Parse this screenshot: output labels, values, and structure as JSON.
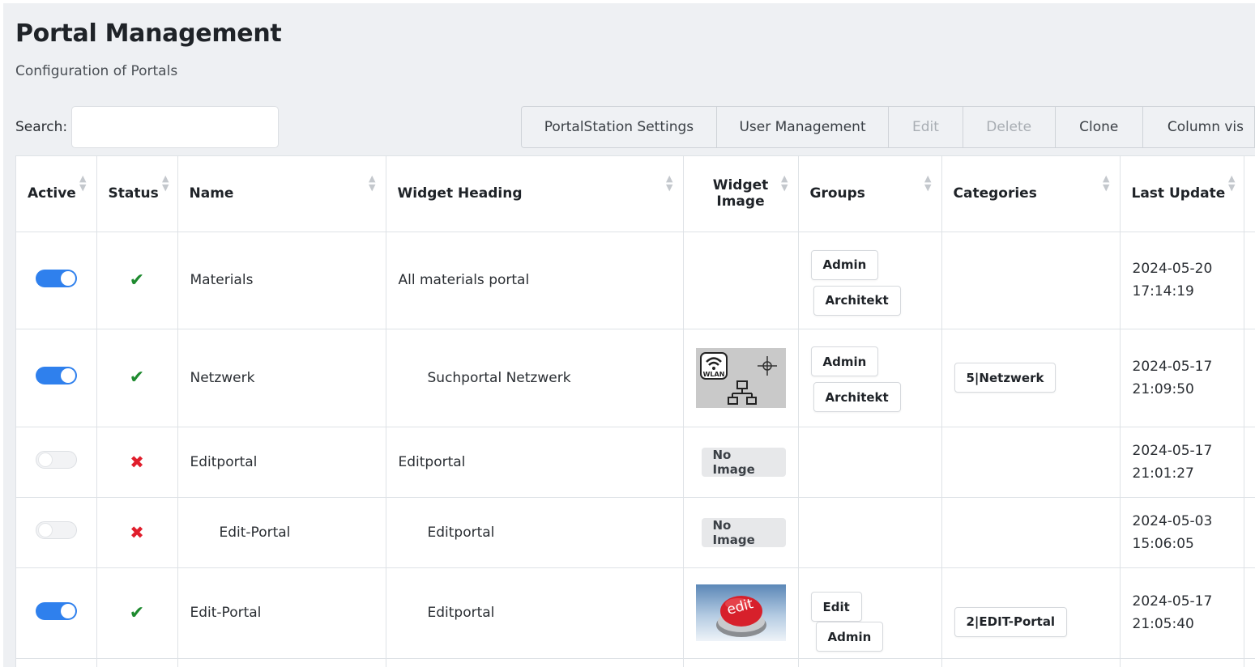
{
  "header": {
    "title": "Portal Management",
    "subtitle": "Configuration of Portals"
  },
  "search": {
    "label": "Search:",
    "value": "",
    "placeholder": ""
  },
  "toolbar": {
    "buttons": [
      {
        "label": "PortalStation Settings",
        "enabled": true
      },
      {
        "label": "User Management",
        "enabled": true
      },
      {
        "label": "Edit",
        "enabled": false
      },
      {
        "label": "Delete",
        "enabled": false
      },
      {
        "label": "Clone",
        "enabled": true
      },
      {
        "label": "Column vis",
        "enabled": true
      }
    ]
  },
  "table": {
    "columns": [
      "Active",
      "Status",
      "Name",
      "Widget Heading",
      "Widget Image",
      "Groups",
      "Categories",
      "Last Update"
    ],
    "widget_image_label": {
      "line1": "Widget",
      "line2": "Image"
    },
    "no_image_label": "No Image",
    "rows": [
      {
        "active": true,
        "status": "ok",
        "name": "Materials",
        "widget_heading": "All materials portal",
        "widget_image": "none",
        "groups": [
          "Admin",
          "Architekt"
        ],
        "categories": [],
        "last_update": {
          "date": "2024-05-20",
          "time": "17:14:19"
        }
      },
      {
        "active": true,
        "status": "ok",
        "name": "Netzwerk",
        "widget_heading": "Suchportal Netzwerk",
        "widget_image": "wlan-network",
        "groups": [
          "Admin",
          "Architekt"
        ],
        "categories": [
          "5|Netzwerk"
        ],
        "last_update": {
          "date": "2024-05-17",
          "time": "21:09:50"
        }
      },
      {
        "active": false,
        "status": "error",
        "name": "Editportal",
        "widget_heading": "Editportal",
        "widget_image": "no-image",
        "groups": [],
        "categories": [],
        "last_update": {
          "date": "2024-05-17",
          "time": "21:01:27"
        }
      },
      {
        "active": false,
        "status": "error",
        "name": "Edit-Portal",
        "widget_heading": "Editportal",
        "widget_image": "no-image",
        "groups": [],
        "categories": [],
        "last_update": {
          "date": "2024-05-03",
          "time": "15:06:05"
        }
      },
      {
        "active": true,
        "status": "ok",
        "name": "Edit-Portal",
        "widget_heading": "Editportal",
        "widget_image": "edit-button",
        "groups": [
          "Edit",
          "Admin"
        ],
        "categories": [
          "2|EDIT-Portal"
        ],
        "last_update": {
          "date": "2024-05-17",
          "time": "21:05:40"
        }
      }
    ]
  },
  "images": {
    "wlan_badge": "WLAN",
    "edit_button": "edit"
  },
  "colors": {
    "toggle_on": "#2f80ed",
    "status_ok": "#1e8a2f",
    "status_error": "#e01e2c"
  }
}
